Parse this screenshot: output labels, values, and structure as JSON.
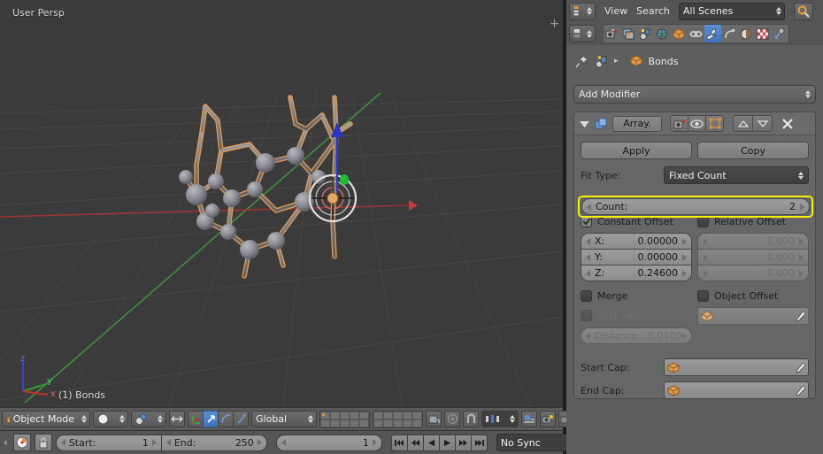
{
  "viewport": {
    "perspective_label": "User Persp",
    "object_label": "(1) Bonds",
    "axis_x": "x",
    "axis_y": "y",
    "axis_z": "z",
    "expand_handle": "+",
    "colors": {
      "background": "#3b3b3b",
      "grid": "#4c4c4c",
      "x_axis": "#a33b3b",
      "y_axis": "#3f8a3f",
      "selected_outline": "#f0a04b",
      "atom": "#8a8a90",
      "manipulator_z": "#2a35c8"
    }
  },
  "viewport_header": {
    "mode": "Object Mode",
    "transform_orientation": "Global",
    "icons": [
      "object-mode-cube-icon",
      "viewport-shading-solid-icon",
      "pivot-point-icon",
      "manipulator-toggle-icon",
      "manipulator-translate-icon",
      "manipulator-rotate-icon",
      "manipulator-scale-icon",
      "layers-icon",
      "lock-camera-icon",
      "proportional-edit-icon",
      "snap-magnet-icon",
      "snap-target-icon",
      "render-preview-icon",
      "render-camera-icon"
    ]
  },
  "timeline": {
    "start_label": "Start:",
    "start_value": "1",
    "end_label": "End:",
    "end_value": "250",
    "current_frame": "1",
    "sync_mode": "No Sync",
    "buttons": [
      "jump-to-start",
      "jump-prev-keyframe",
      "play-reverse",
      "play-forward",
      "jump-next-keyframe",
      "jump-to-end"
    ],
    "toggles": [
      "auto-keyframe-icon",
      "lock-icon"
    ]
  },
  "properties": {
    "header": {
      "editor_type": "properties-editor-icon",
      "menu_view": "View",
      "menu_search": "Search",
      "scene_selector": "All Scenes",
      "browse_icon": "browse-scene-icon"
    },
    "tabs": [
      {
        "name": "render",
        "active": false
      },
      {
        "name": "render-layers",
        "active": false
      },
      {
        "name": "scene",
        "active": false
      },
      {
        "name": "world",
        "active": false
      },
      {
        "name": "object",
        "active": false
      },
      {
        "name": "constraints",
        "active": false
      },
      {
        "name": "modifiers",
        "active": true
      },
      {
        "name": "physics",
        "active": false
      },
      {
        "name": "material",
        "active": false
      },
      {
        "name": "texture",
        "active": false
      },
      {
        "name": "particles",
        "active": false
      }
    ],
    "breadcrumb": {
      "pin_icon": "pin-icon",
      "scene_icon": "scene-icon",
      "separator": "▸",
      "object_icon": "object-cube-icon",
      "object_name": "Bonds"
    },
    "add_modifier": "Add Modifier",
    "modifier": {
      "expand_icon": "collapse-triangle-icon",
      "type_icon": "array-modifier-icon",
      "name": "Array.",
      "toggle_render": "render-toggle-icon",
      "toggle_realtime": "viewport-toggle-icon",
      "toggle_editmode": "editmode-toggle-icon",
      "move_up": "move-up-icon",
      "move_down": "move-down-icon",
      "delete": "delete-x-icon",
      "apply_label": "Apply",
      "copy_label": "Copy",
      "fit_type_label": "Fit Type:",
      "fit_type_value": "Fixed Count",
      "count_label": "Count:",
      "count_value": "2",
      "count_highlighted": true,
      "highlight_color": "#f5f00c",
      "constant_offset": {
        "label": "Constant Offset",
        "checked": true,
        "x_label": "X:",
        "x_value": "0.00000",
        "y_label": "Y:",
        "y_value": "0.00000",
        "z_label": "Z:",
        "z_value": "0.24600"
      },
      "relative_offset": {
        "label": "Relative Offset",
        "checked": false,
        "x_value": "1.000",
        "y_value": "0.000",
        "z_value": "0.000"
      },
      "merge": {
        "label": "Merge",
        "checked": false,
        "first_last_label": "First Last",
        "first_last_checked": false,
        "distance_label": "Distance:",
        "distance_value": "0.0100"
      },
      "object_offset": {
        "label": "Object Offset",
        "checked": false,
        "field_icon": "object-cube-icon",
        "eyedropper": "eyedropper-icon"
      },
      "start_cap_label": "Start Cap:",
      "start_cap_value": "",
      "end_cap_label": "End Cap:",
      "end_cap_value": ""
    }
  }
}
